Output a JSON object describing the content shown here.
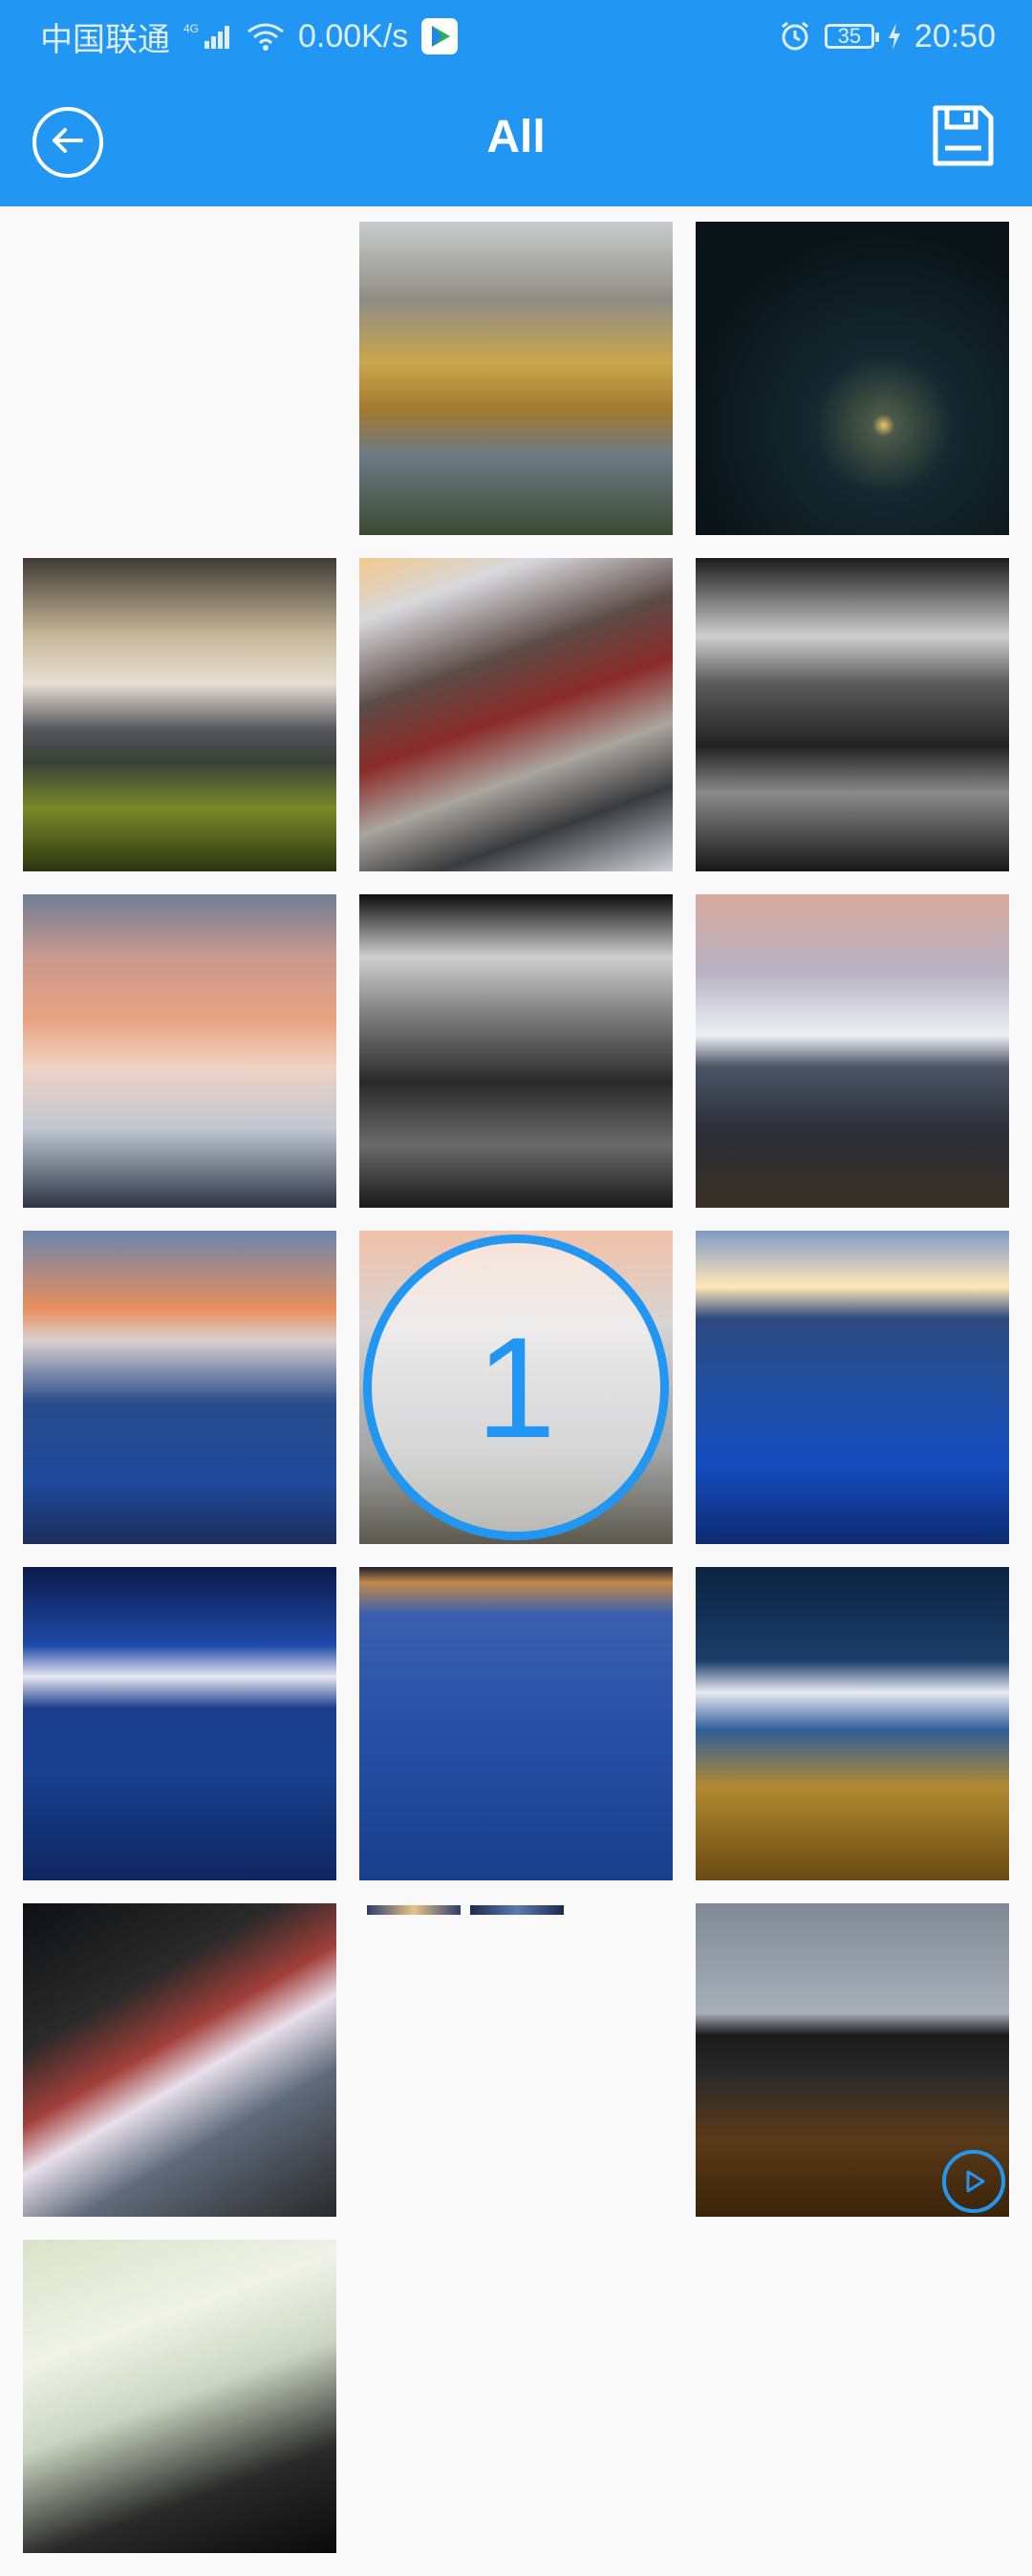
{
  "status_bar": {
    "carrier": "中国联通",
    "network_type": "4G",
    "speed": "0.00K/s",
    "battery": "35",
    "time": "20:50"
  },
  "app_bar": {
    "title": "All",
    "back_icon": "back-arrow-icon",
    "save_icon": "save-icon"
  },
  "accent_color": "#2196f3",
  "grid": {
    "selected_index": 10,
    "selected_label": "1",
    "video_index": 17
  }
}
